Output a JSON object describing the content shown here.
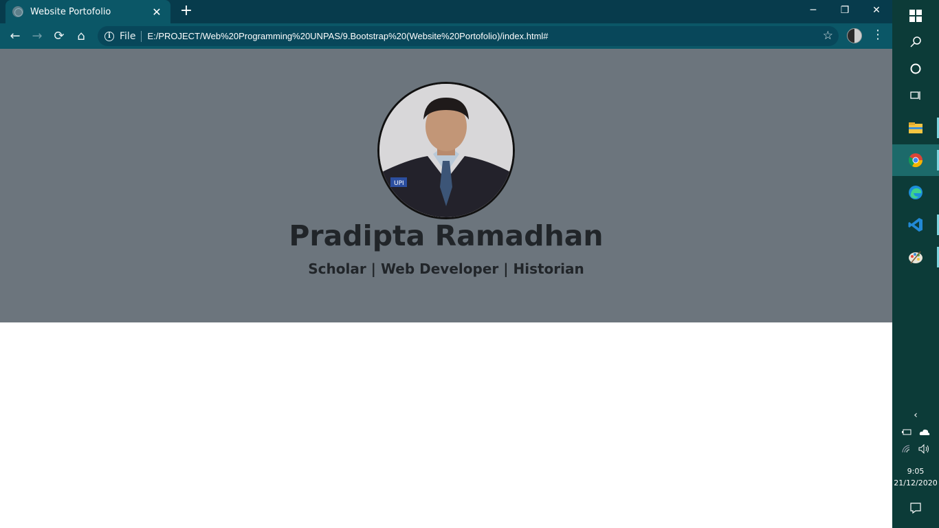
{
  "browser": {
    "tab_title": "Website Portofolio",
    "tab_close": "✕",
    "new_tab": "+",
    "window_controls": {
      "minimize": "─",
      "restore": "❐",
      "close": "✕"
    },
    "nav": {
      "back": "←",
      "forward": "→",
      "reload": "⟳",
      "home": "⌂"
    },
    "omnibox": {
      "info_icon": "i",
      "scheme_label": "File",
      "url": "E:/PROJECT/Web%20Programming%20UNPAS/9.Bootstrap%20(Website%20Portofolio)/index.html#",
      "bookmark_icon": "☆"
    },
    "menu": "⋮"
  },
  "page": {
    "name": "Pradipta Ramadhan",
    "subtitle": "Scholar | Web Developer | Historian",
    "jumbotron_color": "#6c757d"
  },
  "taskbar": {
    "clock_time": "9:05",
    "clock_date": "21/12/2020",
    "apps": [
      "windows-start-icon",
      "search-icon",
      "cortana-icon",
      "task-view-icon",
      "file-explorer-icon",
      "chrome-icon",
      "edge-icon",
      "vscode-icon",
      "paint-icon"
    ]
  }
}
